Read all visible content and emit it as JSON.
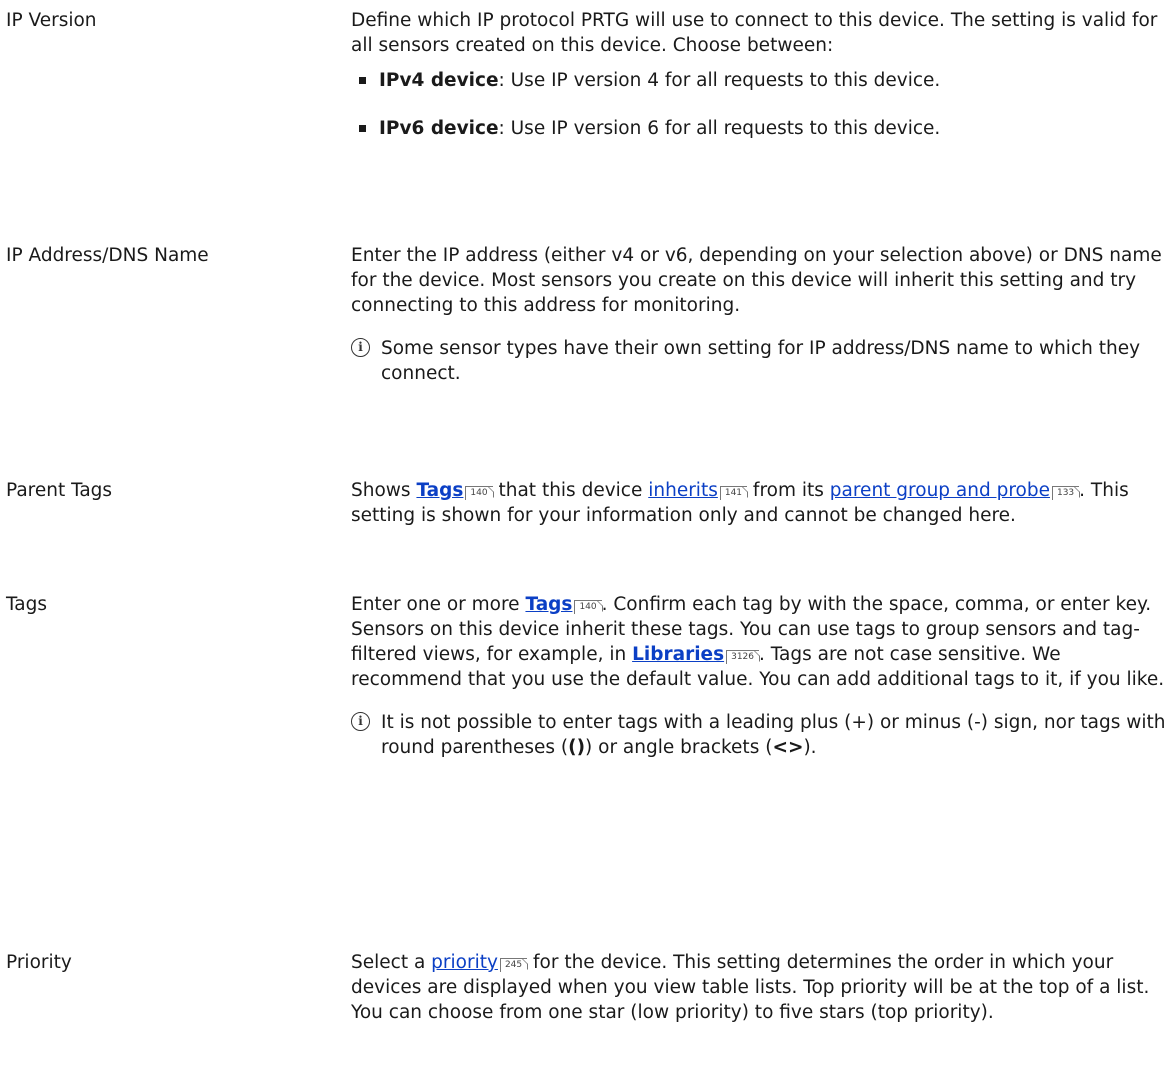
{
  "rows": {
    "ip_version": {
      "label": "IP Version",
      "desc": "Define which IP protocol PRTG will use to connect to this device. The setting is valid for all sensors created on this device. Choose between:",
      "bullets": [
        {
          "term": "IPv4 device",
          "text": ": Use IP version 4 for all requests to this device."
        },
        {
          "term": "IPv6 device",
          "text": ": Use IP version 6 for all requests to this device."
        }
      ]
    },
    "ip_address": {
      "label": "IP Address/DNS Name",
      "desc": "Enter the IP address (either v4 or v6, depending on your selection above) or DNS name for the device. Most sensors you create on this device will inherit this setting and try connecting to this address for monitoring.",
      "note": "Some sensor types have their own setting for IP address/DNS name to which they connect."
    },
    "parent_tags": {
      "label": "Parent Tags",
      "t1": "Shows ",
      "link1": "Tags",
      "ref1": "140",
      "t2": " that this device ",
      "link2": "inherits",
      "ref2": "141",
      "t3": " from its ",
      "link3": "parent group and probe",
      "ref3": "133",
      "t4": ". This setting is shown for your information only and cannot be changed here."
    },
    "tags": {
      "label": "Tags",
      "t1": "Enter one or more ",
      "link1": "Tags",
      "ref1": "140",
      "t2": ". Confirm each tag by with the space, comma, or enter key. Sensors on this device inherit these tags. You can use tags to group sensors and tag-filtered views, for example, in ",
      "link2": "Libraries",
      "ref2": "3126",
      "t3": ". Tags are not case sensitive. We recommend that you use the default value. You can add additional tags to it, if you like.",
      "note_t1": "It is not possible to enter tags with a leading plus (+) or minus (-) sign, nor tags with round parentheses (",
      "note_b1": "()",
      "note_t2": ") or angle brackets (",
      "note_b2": "<>",
      "note_t3": ")."
    },
    "priority": {
      "label": "Priority",
      "t1": "Select a ",
      "link1": "priority",
      "ref1": "245",
      "t2": " for the device. This setting determines the order in which your devices are displayed when you view table lists. Top priority will be at the top of a list. You can choose from one star (low priority) to five stars (top priority)."
    }
  }
}
